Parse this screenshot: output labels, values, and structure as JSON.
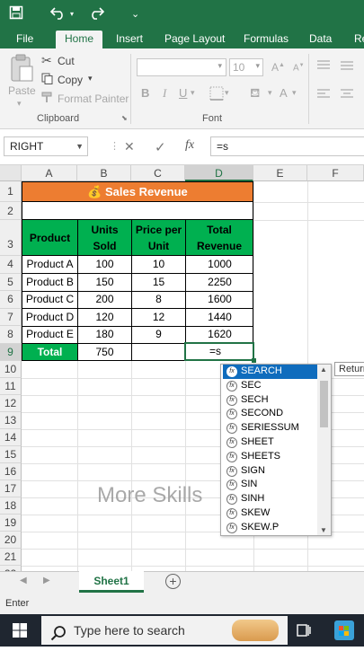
{
  "ribbon_tabs": [
    "File",
    "Home",
    "Insert",
    "Page Layout",
    "Formulas",
    "Data",
    "Re"
  ],
  "clipboard": {
    "paste": "Paste",
    "cut": "Cut",
    "copy": "Copy",
    "format_painter": "Format Painter",
    "group_label": "Clipboard"
  },
  "font": {
    "size": "10",
    "bold": "B",
    "italic": "I",
    "underline": "U",
    "font_color": "A",
    "group_label": "Font"
  },
  "formula_bar": {
    "name_box": "RIGHT",
    "cancel": "✕",
    "enter": "✓",
    "fx": "fx",
    "value": "=s"
  },
  "columns": [
    "A",
    "B",
    "C",
    "D",
    "E",
    "F"
  ],
  "rows": [
    "1",
    "2",
    "3",
    "4",
    "5",
    "6",
    "7",
    "8",
    "9",
    "10",
    "11",
    "12",
    "13",
    "14",
    "15",
    "16",
    "17",
    "18",
    "19",
    "20",
    "21",
    "22"
  ],
  "table": {
    "title": "Sales Revenue",
    "headers": [
      "Product",
      "Units Sold",
      "Price per Unit",
      "Total Revenue"
    ],
    "rows": [
      [
        "Product A",
        "100",
        "10",
        "1000"
      ],
      [
        "Product B",
        "150",
        "15",
        "2250"
      ],
      [
        "Product C",
        "200",
        "8",
        "1600"
      ],
      [
        "Product D",
        "120",
        "12",
        "1440"
      ],
      [
        "Product E",
        "180",
        "9",
        "1620"
      ]
    ],
    "total_label": "Total",
    "total_units": "750",
    "editing_value": "=s"
  },
  "autocomplete": [
    "SEARCH",
    "SEC",
    "SECH",
    "SECOND",
    "SERIESSUM",
    "SHEET",
    "SHEETS",
    "SIGN",
    "SIN",
    "SINH",
    "SKEW",
    "SKEW.P"
  ],
  "autocomplete_selected": "SEARCH",
  "tooltip": "Returns",
  "watermark": "More Skills",
  "sheet_tab": "Sheet1",
  "status": "Enter",
  "taskbar": {
    "search_placeholder": "Type here to search"
  },
  "colors": {
    "excel_green": "#217346",
    "title_orange": "#ed7d31",
    "header_green": "#00b050",
    "selection_blue": "#0f6cbd"
  }
}
